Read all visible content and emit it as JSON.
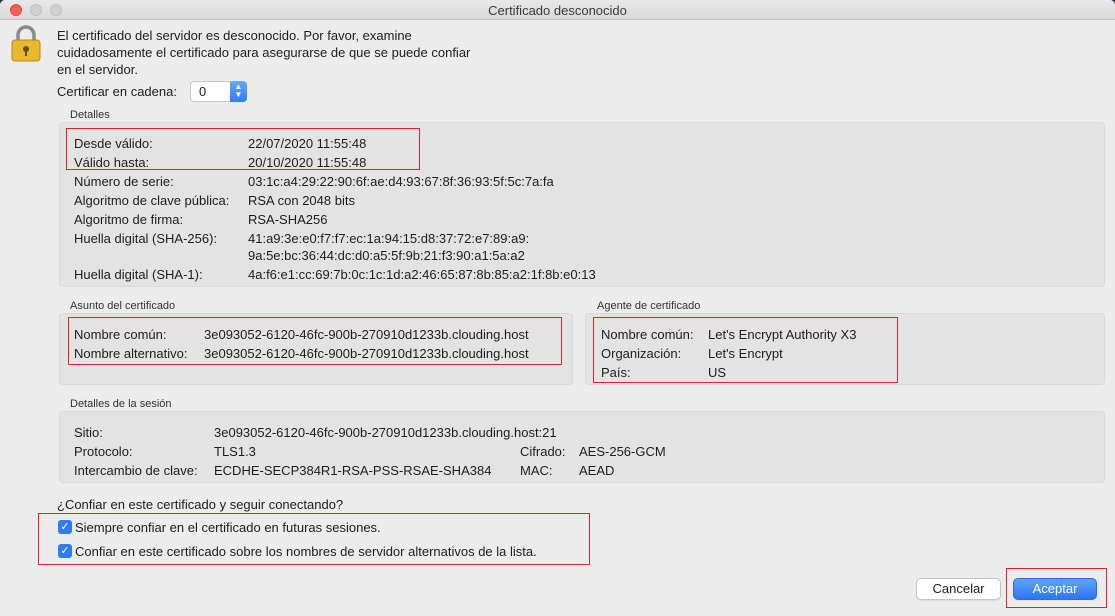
{
  "window": {
    "title": "Certificado desconocido"
  },
  "intro": "El certificado del servidor es desconocido. Por favor, examine cuidadosamente el certificado para asegurarse de que se puede confiar en el servidor.",
  "chain": {
    "label": "Certificar en cadena:",
    "value": "0"
  },
  "details": {
    "label": "Detalles",
    "valid_from_label": "Desde válido:",
    "valid_from": "22/07/2020 11:55:48",
    "valid_until_label": "Válido hasta:",
    "valid_until": "20/10/2020 11:55:48",
    "serial_label": "Número de serie:",
    "serial": "03:1c:a4:29:22:90:6f:ae:d4:93:67:8f:36:93:5f:5c:7a:fa",
    "pubkey_label": "Algoritmo de clave pública:",
    "pubkey": "RSA con 2048 bits",
    "sig_label": "Algoritmo de firma:",
    "sig": "RSA-SHA256",
    "sha256_label": "Huella digital (SHA-256):",
    "sha256_line1": "41:a9:3e:e0:f7:f7:ec:1a:94:15:d8:37:72:e7:89:a9:",
    "sha256_line2": "9a:5e:bc:36:44:dc:d0:a5:5f:9b:21:f3:90:a1:5a:a2",
    "sha1_label": "Huella digital (SHA-1):",
    "sha1": "4a:f6:e1:cc:69:7b:0c:1c:1d:a2:46:65:87:8b:85:a2:1f:8b:e0:13"
  },
  "subject": {
    "label": "Asunto del certificado",
    "cn_label": "Nombre común:",
    "cn": "3e093052-6120-46fc-900b-270910d1233b.clouding.host",
    "alt_label": "Nombre alternativo:",
    "alt": "3e093052-6120-46fc-900b-270910d1233b.clouding.host"
  },
  "issuer": {
    "label": "Agente de certificado",
    "cn_label": "Nombre común:",
    "cn": "Let's Encrypt Authority X3",
    "org_label": "Organización:",
    "org": "Let's Encrypt",
    "country_label": "País:",
    "country": "US"
  },
  "session": {
    "label": "Detalles de la sesión",
    "site_label": "Sitio:",
    "site": "3e093052-6120-46fc-900b-270910d1233b.clouding.host:21",
    "protocol_label": "Protocolo:",
    "protocol": "TLS1.3",
    "cipher_label": "Cifrado:",
    "cipher": "AES-256-GCM",
    "kex_label": "Intercambio de clave:",
    "kex": "ECDHE-SECP384R1-RSA-PSS-RSAE-SHA384",
    "mac_label": "MAC:",
    "mac": "AEAD"
  },
  "trust": {
    "question": "¿Confiar en este certificado y seguir conectando?",
    "always": "Siempre confiar en el certificado en futuras sesiones.",
    "alt_names": "Confiar en este certificado sobre los nombres de servidor alternativos de la lista."
  },
  "buttons": {
    "cancel": "Cancelar",
    "accept": "Aceptar"
  },
  "colors": {
    "accent": "#2f7cf3",
    "highlight": "#d9262c",
    "lock": "#e8b830"
  }
}
